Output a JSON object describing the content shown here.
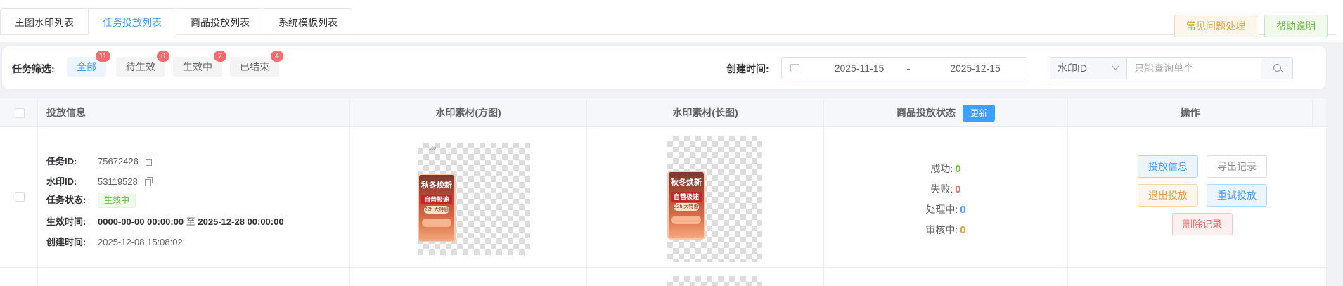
{
  "tabs": [
    {
      "label": "主图水印列表",
      "active": false
    },
    {
      "label": "任务投放列表",
      "active": true
    },
    {
      "label": "商品投放列表",
      "active": false
    },
    {
      "label": "系统模板列表",
      "active": false
    }
  ],
  "top_buttons": {
    "faq": "常见问题处理",
    "help": "帮助说明"
  },
  "filter": {
    "label": "任务筛选:",
    "buttons": [
      {
        "label": "全部",
        "count": "11",
        "active": true
      },
      {
        "label": "待生效",
        "count": "0",
        "active": false
      },
      {
        "label": "生效中",
        "count": "7",
        "active": false
      },
      {
        "label": "已结束",
        "count": "4",
        "active": false
      }
    ],
    "date_label": "创建时间:",
    "date_start": "2025-11-15",
    "date_sep": "-",
    "date_end": "2025-12-15",
    "search_type": "水印ID",
    "search_placeholder": "只能查询单个"
  },
  "table": {
    "headers": {
      "info": "投放信息",
      "square": "水印素材(方图)",
      "long": "水印素材(长图)",
      "status": "商品投放状态",
      "update": "更新",
      "ops": "操作"
    },
    "row": {
      "labels": {
        "task_id": "任务ID:",
        "wm_id": "水印ID:",
        "task_status": "任务状态:",
        "effective": "生效时间:",
        "created": "创建时间:"
      },
      "task_id": "75672426",
      "wm_id": "53119528",
      "status_tag": "生效中",
      "effective_start": "0000-00-00 00:00:00",
      "effective_to": "至",
      "effective_end": "2025-12-28 00:00:00",
      "created": "2025-12-08 15:08:02",
      "square_tiny": "103",
      "wm_title": "秋冬焕新",
      "wm_sub": "自营极速达",
      "wm_sub2": "22h 大特惠",
      "stats": {
        "success_label": "成功:",
        "success": "0",
        "fail_label": "失败:",
        "fail": "0",
        "processing_label": "处理中:",
        "processing": "0",
        "review_label": "审核中:",
        "review": "0"
      },
      "ops": {
        "info": "投放信息",
        "export": "导出记录",
        "exit": "退出投放",
        "retry": "重试投放",
        "delete": "删除记录"
      }
    },
    "colors": {
      "success": "#67c23a",
      "fail": "#f56c6c",
      "processing": "#409eff",
      "review": "#e6a23c",
      "accent": "#409eff"
    }
  }
}
